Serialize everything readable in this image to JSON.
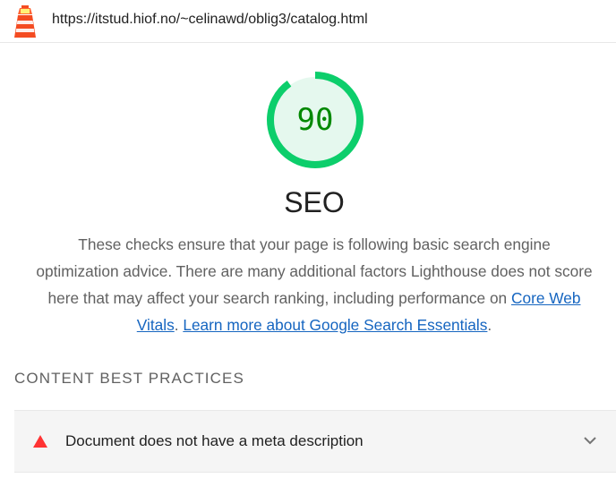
{
  "header": {
    "url": "https://itstud.hiof.no/~celinawd/oblig3/catalog.html",
    "logo_icon": "lighthouse-icon"
  },
  "score": {
    "value": "90",
    "fraction": 0.9,
    "color": "#0cce6b"
  },
  "category": {
    "title": "SEO",
    "description_text": "These checks ensure that your page is following basic search engine optimization advice. There are many additional factors Lighthouse does not score here that may affect your search ranking, including performance on ",
    "link1": "Core Web Vitals",
    "separator": ". ",
    "link2": "Learn more about Google Search Essentials",
    "end": "."
  },
  "groups": [
    {
      "title": "CONTENT BEST PRACTICES",
      "audits": [
        {
          "icon": "fail-triangle-icon",
          "title": "Document does not have a meta description",
          "status_color": "#ff3333"
        }
      ]
    }
  ]
}
